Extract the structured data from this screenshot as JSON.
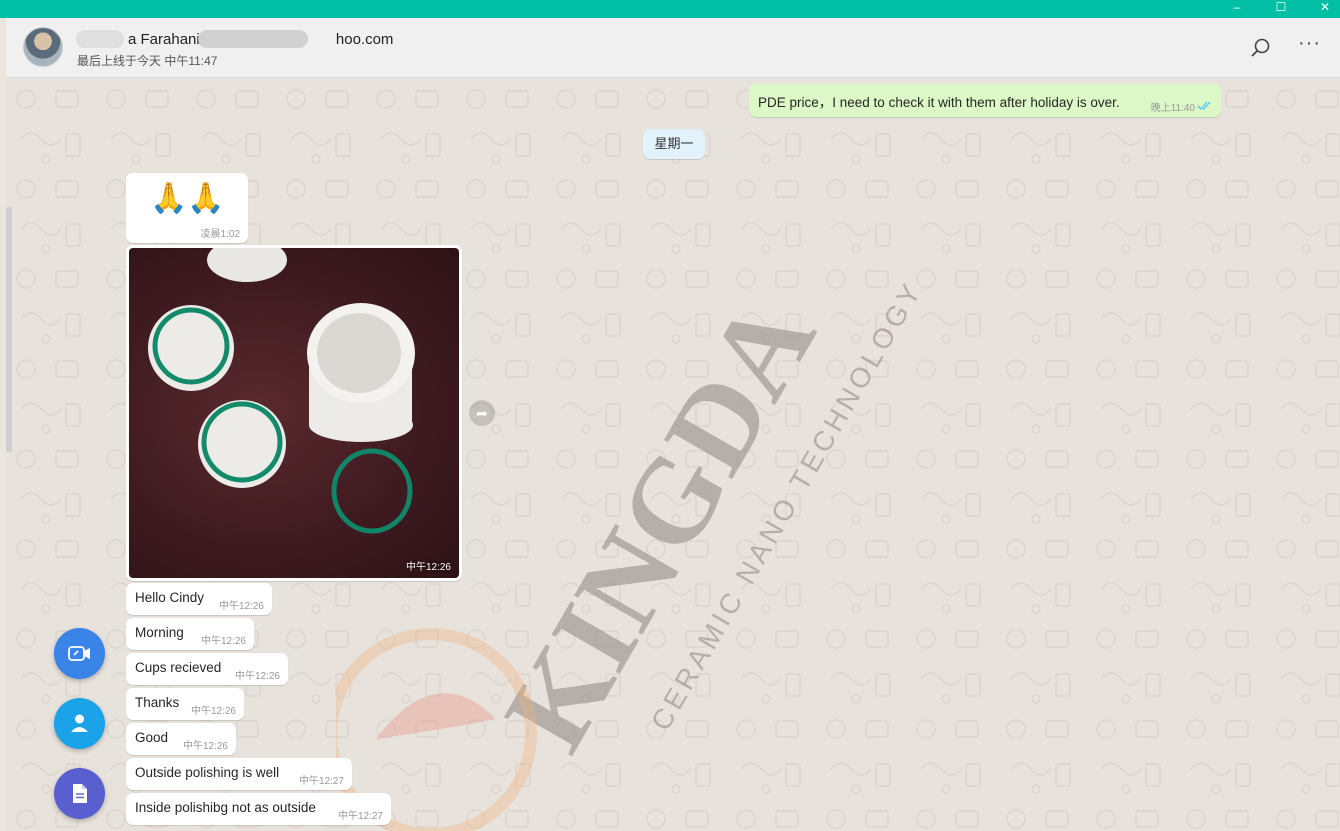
{
  "window": {
    "minimize_glyph": "–",
    "maximize_glyph": "☐",
    "close_glyph": "✕",
    "accent_color": "#00bfa5"
  },
  "header": {
    "contact_name_visible": "a Farahani",
    "contact_email_visible": "hoo.com",
    "last_seen": "最后上线于今天 中午11:47",
    "icons": [
      "avatar",
      "search-icon",
      "more-icon"
    ]
  },
  "chat": {
    "outgoing": {
      "text": "PDE price，I need to check it with them after holiday is over.",
      "time": "晚上11:40",
      "status": "read-double-check"
    },
    "day_separator": "星期一",
    "emoji_message": {
      "text": "🙏🙏",
      "time": "凌晨1:02"
    },
    "photo_message": {
      "time": "中午12:26",
      "description_icon": "forward-icon"
    },
    "messages": [
      {
        "text": "Hello Cindy",
        "time": "中午12:26"
      },
      {
        "text": "Morning",
        "time": "中午12:26"
      },
      {
        "text": "Cups recieved",
        "time": "中午12:26"
      },
      {
        "text": "Thanks",
        "time": "中午12:26"
      },
      {
        "text": "Good",
        "time": "中午12:26"
      },
      {
        "text": "Outside polishing is well",
        "time": "中午12:27"
      },
      {
        "text": "Inside polishibg not as outside",
        "time": "中午12:27"
      }
    ]
  },
  "watermark": {
    "brand": "KINGDA",
    "tagline": "CERAMIC NANO TECHNOLOGY"
  },
  "fab": {
    "items": [
      "video-link-icon",
      "contact-icon",
      "document-icon"
    ]
  }
}
